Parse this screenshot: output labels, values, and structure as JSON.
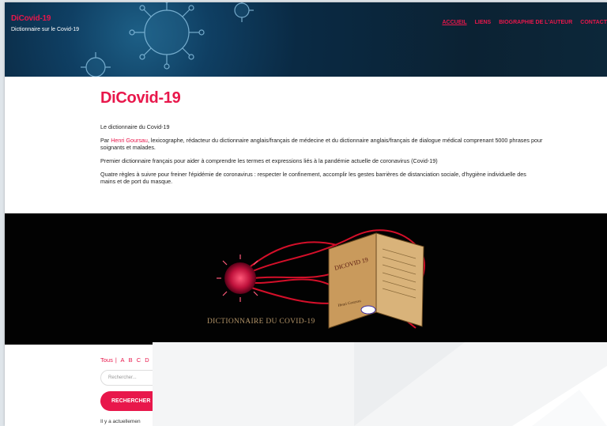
{
  "site": {
    "title": "DiCovid-19",
    "tagline": "Dictionnaire sur le Covid-19"
  },
  "nav": {
    "items": [
      {
        "label": "ACCUEIL",
        "active": true
      },
      {
        "label": "LIENS",
        "active": false
      },
      {
        "label": "BIOGRAPHIE DE L'AUTEUR",
        "active": false
      },
      {
        "label": "CONTACT",
        "active": false
      }
    ]
  },
  "main": {
    "title": "DiCovid-19",
    "p1": "Le dictionnaire du Covid-19",
    "p2_prefix": "Par ",
    "p2_author": "Henri Goursau",
    "p2_suffix": ", lexicographe, rédacteur du dictionnaire anglais/français de médecine et du dictionnaire anglais/français de dialogue médical comprenant 5000 phrases pour soignants et malades.",
    "p3": "Premier dictionnaire français pour aider à comprendre les termes et expressions liés à la pandémie actuelle de coronavirus (Covid-19)",
    "p4": "Quatre règles à suivre pour freiner l'épidémie de coronavirus : respecter le confinement, accomplir les gestes barrières de distanciation sociale, d'hygiène individuelle des mains et de port du masque."
  },
  "banner": {
    "book_title": "DICOVID 19",
    "book_author": "Henri Goursau",
    "caption": "DICTIONNAIRE DU COVID-19"
  },
  "filter": {
    "all_label": "Tous",
    "separator": "|",
    "letters": [
      "A",
      "B",
      "C",
      "D"
    ]
  },
  "search": {
    "placeholder": "Rechercher...",
    "button_label": "RECHERCHER"
  },
  "footer_text": "Il y a actuellemen",
  "colors": {
    "accent": "#e8174b",
    "header_bg": "#0b2233",
    "banner_bg": "#020202"
  }
}
